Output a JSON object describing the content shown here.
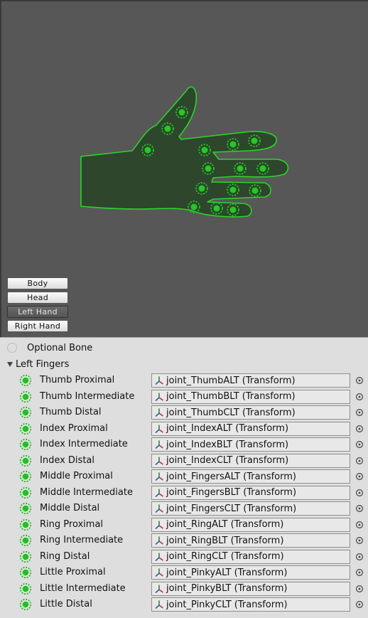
{
  "viewport": {
    "tabs": [
      {
        "label": "Body",
        "active": false
      },
      {
        "label": "Head",
        "active": false
      },
      {
        "label": "Left Hand",
        "active": true
      },
      {
        "label": "Right Hand",
        "active": false
      }
    ],
    "accent_color": "#26c826",
    "hand_fill": "#2d462c",
    "hand_stroke": "#2bd42b"
  },
  "legend": {
    "label": "Optional Bone",
    "icon": "optional-bone-icon"
  },
  "foldout": {
    "label": "Left Fingers",
    "expanded": true
  },
  "bones": [
    {
      "label": "Thumb Proximal",
      "value": "joint_ThumbALT (Transform)"
    },
    {
      "label": "Thumb Intermediate",
      "value": "joint_ThumbBLT (Transform)"
    },
    {
      "label": "Thumb Distal",
      "value": "joint_ThumbCLT (Transform)"
    },
    {
      "label": "Index Proximal",
      "value": "joint_IndexALT (Transform)"
    },
    {
      "label": "Index Intermediate",
      "value": "joint_IndexBLT (Transform)"
    },
    {
      "label": "Index Distal",
      "value": "joint_IndexCLT (Transform)"
    },
    {
      "label": "Middle Proximal",
      "value": "joint_FingersALT (Transform)"
    },
    {
      "label": "Middle Intermediate",
      "value": "joint_FingersBLT (Transform)"
    },
    {
      "label": "Middle Distal",
      "value": "joint_FingersCLT (Transform)"
    },
    {
      "label": "Ring Proximal",
      "value": "joint_RingALT (Transform)"
    },
    {
      "label": "Ring Intermediate",
      "value": "joint_RingBLT (Transform)"
    },
    {
      "label": "Ring Distal",
      "value": "joint_RingCLT (Transform)"
    },
    {
      "label": "Little Proximal",
      "value": "joint_PinkyALT (Transform)"
    },
    {
      "label": "Little Intermediate",
      "value": "joint_PinkyBLT (Transform)"
    },
    {
      "label": "Little Distal",
      "value": "joint_PinkyCLT (Transform)"
    }
  ]
}
